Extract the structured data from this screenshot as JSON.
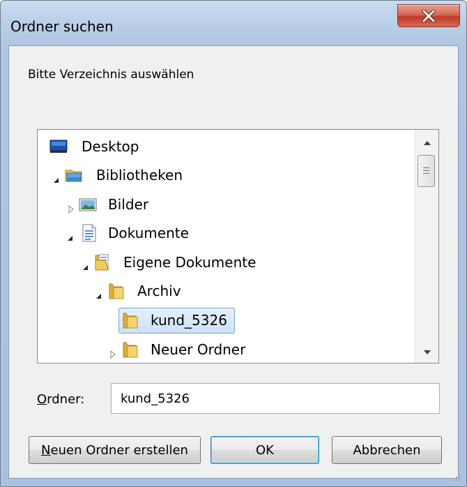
{
  "dialog": {
    "title": "Ordner suchen",
    "close_label": "Schließen",
    "instruction": "Bitte Verzeichnis auswählen"
  },
  "tree": {
    "items": [
      {
        "label": "Desktop",
        "icon": "desktop-icon",
        "expander": "none"
      },
      {
        "label": "Bibliotheken",
        "icon": "libraries-icon",
        "expander": "expanded"
      },
      {
        "label": "Bilder",
        "icon": "pictures-library-icon",
        "expander": "collapsed"
      },
      {
        "label": "Dokumente",
        "icon": "documents-library-icon",
        "expander": "expanded"
      },
      {
        "label": "Eigene Dokumente",
        "icon": "documents-folder-icon",
        "expander": "expanded"
      },
      {
        "label": "Archiv",
        "icon": "folder-icon",
        "expander": "expanded"
      },
      {
        "label": "kund_5326",
        "icon": "folder-icon",
        "expander": "none",
        "selected": true
      },
      {
        "label": "Neuer Ordner",
        "icon": "folder-icon",
        "expander": "collapsed"
      }
    ]
  },
  "folder_field": {
    "label_accel": "O",
    "label_rest": "rdner:",
    "value": "kund_5326"
  },
  "buttons": {
    "new_folder_accel": "N",
    "new_folder_rest": "euen Ordner erstellen",
    "ok": "OK",
    "cancel": "Abbrechen"
  },
  "colors": {
    "title_bar": "#b7cde6",
    "close_button": "#c0392b",
    "selection": "#cde2f8",
    "selection_border": "#7da2ce"
  }
}
